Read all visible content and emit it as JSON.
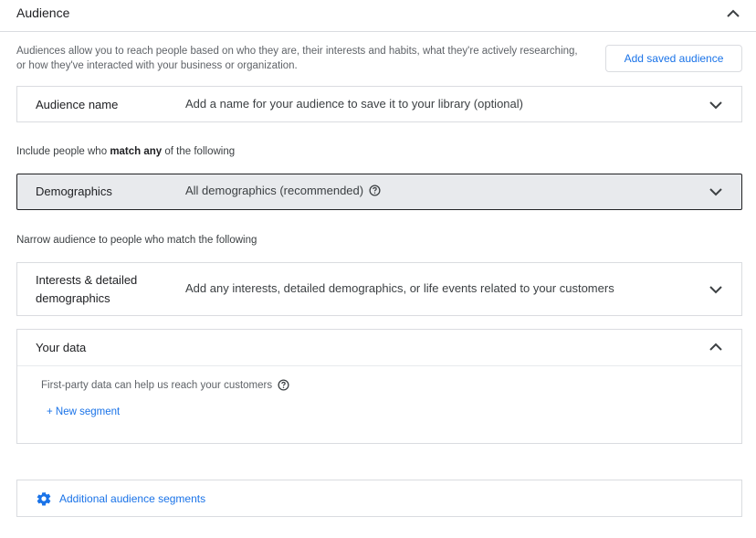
{
  "header": {
    "title": "Audience"
  },
  "description": {
    "line1": "Audiences allow you to reach people based on who they are, their interests and habits, what they're actively researching,",
    "line2": "or how they've interacted with your business or organization."
  },
  "buttons": {
    "add_saved_audience": "Add saved audience"
  },
  "audience_name": {
    "label": "Audience name",
    "placeholder": "Add a name for your audience to save it to your library (optional)"
  },
  "include": {
    "prefix": "Include people who ",
    "bold": "match any",
    "suffix": " of the following"
  },
  "demographics": {
    "label": "Demographics",
    "value": "All demographics (recommended)"
  },
  "narrow": {
    "text": "Narrow audience to people who match the following"
  },
  "interests": {
    "label": "Interests & detailed demographics",
    "value": "Add any interests, detailed demographics, or life events related to your customers"
  },
  "your_data": {
    "label": "Your data",
    "help_text": "First-party data can help us reach your customers",
    "new_segment": "+ New segment"
  },
  "additional": {
    "label": "Additional audience segments"
  },
  "colors": {
    "accent": "#1a73e8",
    "border": "#dadce0",
    "selected_bg": "#e8eaed"
  }
}
